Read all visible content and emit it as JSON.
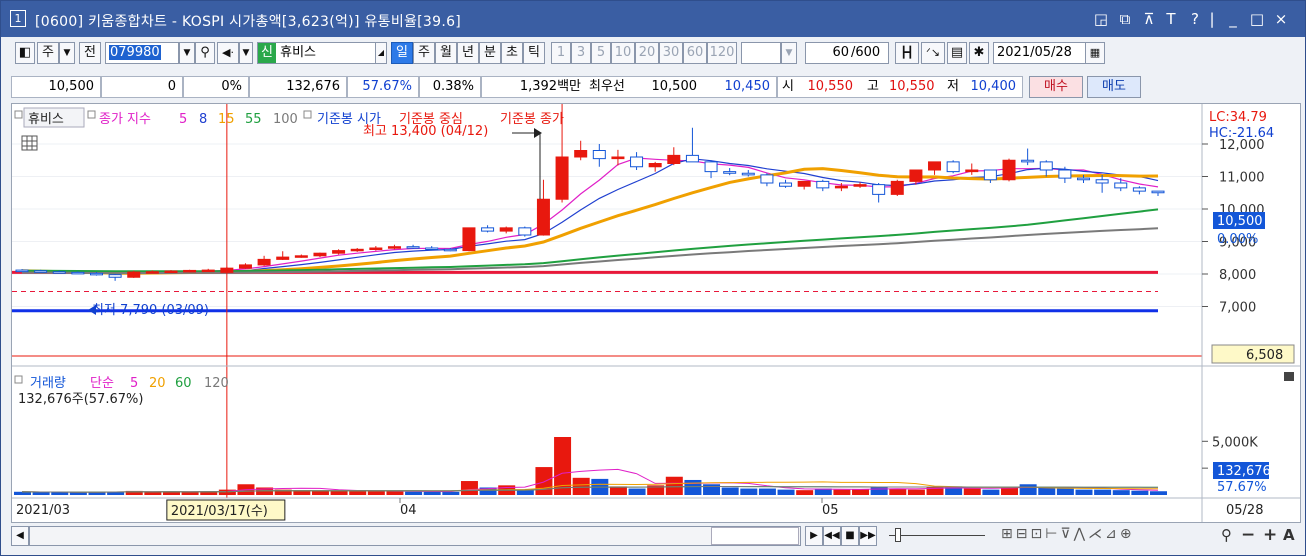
{
  "title": {
    "number": "1",
    "text": "[0600] 키움종합차트 - KOSPI 시가총액[3,623(억)] 유통비율[39.6]"
  },
  "title_controls": [
    "layout-icon",
    "window-icon",
    "pin-icon",
    "font-icon",
    "help-icon",
    "minimize-icon",
    "maximize-icon",
    "close-icon"
  ],
  "toolbar": {
    "stock_label": "주",
    "prev_label": "전",
    "code": "079980",
    "market_badge": "신",
    "name": "휴비스",
    "periods": [
      "일",
      "주",
      "월",
      "년",
      "분",
      "초",
      "틱"
    ],
    "active_period": "일",
    "intervals": [
      "1",
      "3",
      "5",
      "10",
      "20",
      "30",
      "60",
      "120"
    ],
    "count": "60",
    "count_total": "/600",
    "date": "2021/05/28"
  },
  "quote": {
    "price": "10,500",
    "change": "0",
    "rate": "0%",
    "volume": "132,676",
    "volume_ratio": "57.67%",
    "turnover": "0.38%",
    "amount": "1,392백만",
    "best_label": "최우선",
    "ask": "10,500",
    "bid": "10,450",
    "open_label": "시",
    "open": "10,550",
    "high_label": "고",
    "high": "10,550",
    "low_label": "저",
    "low": "10,400",
    "buy": "매수",
    "sell": "매도"
  },
  "price_legend": {
    "name": "휴비스",
    "ma_label": "종가 지수",
    "ma": [
      "5",
      "8",
      "15",
      "55",
      "100"
    ],
    "ref_open": "기준봉 시가",
    "ref_mid": "기준봉 중심",
    "ref_close": "기준봉 종가",
    "max_note": "최고 13,400 (04/12)",
    "min_note": "최저 7,790 (03/09)",
    "lc": "LC:34.79",
    "hc": "HC:-21.64"
  },
  "price_axis": {
    "ticks": [
      "12,000",
      "11,000",
      "10,000",
      "9,000",
      "8,000",
      "7,000"
    ],
    "current": "10,500",
    "current_pct": "0.00%",
    "marker": "6,508"
  },
  "volume_legend": {
    "label": "거래량",
    "ma_label": "단순",
    "ma": [
      "5",
      "20",
      "60",
      "120"
    ],
    "current": "132,676주(57.67%)"
  },
  "volume_axis": {
    "ticks": [
      "5,000K",
      "2,500K"
    ],
    "current": "132,676",
    "pct": "57.67%"
  },
  "date_axis": {
    "labels": [
      "2021/03",
      "04",
      "05",
      "05/28"
    ],
    "crosshair": "2021/03/17(수)"
  },
  "colors": {
    "up": "#e8180e",
    "down": "#1356d8",
    "ma5": "#e020c8",
    "ma8": "#2040d0",
    "ma15": "#f0a000",
    "ma55": "#20a040",
    "ma100": "#7a7a7a",
    "title": "#3a5ea3"
  },
  "chart_data": {
    "type": "candlestick",
    "dates": [
      "03/02",
      "03/03",
      "03/04",
      "03/05",
      "03/08",
      "03/09",
      "03/10",
      "03/11",
      "03/12",
      "03/15",
      "03/16",
      "03/17",
      "03/18",
      "03/19",
      "03/22",
      "03/23",
      "03/24",
      "03/25",
      "03/26",
      "03/29",
      "03/30",
      "03/31",
      "04/01",
      "04/02",
      "04/05",
      "04/06",
      "04/07",
      "04/08",
      "04/09",
      "04/12",
      "04/13",
      "04/14",
      "04/15",
      "04/16",
      "04/19",
      "04/20",
      "04/21",
      "04/22",
      "04/23",
      "04/26",
      "04/27",
      "04/28",
      "04/29",
      "04/30",
      "05/03",
      "05/04",
      "05/06",
      "05/07",
      "05/10",
      "05/11",
      "05/12",
      "05/13",
      "05/14",
      "05/17",
      "05/18",
      "05/20",
      "05/21",
      "05/24",
      "05/25",
      "05/26",
      "05/27",
      "05/28"
    ],
    "ohlc": [
      [
        8120,
        8150,
        8090,
        8100
      ],
      [
        8100,
        8130,
        8050,
        8070
      ],
      [
        8070,
        8110,
        8020,
        8050
      ],
      [
        8050,
        8080,
        8000,
        8020
      ],
      [
        8020,
        8060,
        7950,
        7980
      ],
      [
        7980,
        8000,
        7790,
        7900
      ],
      [
        7900,
        8100,
        7880,
        8060
      ],
      [
        8060,
        8110,
        8030,
        8070
      ],
      [
        8070,
        8120,
        8030,
        8090
      ],
      [
        8090,
        8130,
        8050,
        8110
      ],
      [
        8110,
        8160,
        8080,
        8120
      ],
      [
        8050,
        8220,
        8040,
        8180
      ],
      [
        8180,
        8330,
        8160,
        8280
      ],
      [
        8280,
        8560,
        8250,
        8450
      ],
      [
        8450,
        8700,
        8430,
        8520
      ],
      [
        8520,
        8600,
        8500,
        8560
      ],
      [
        8560,
        8660,
        8520,
        8640
      ],
      [
        8640,
        8760,
        8600,
        8720
      ],
      [
        8720,
        8800,
        8680,
        8760
      ],
      [
        8760,
        8860,
        8720,
        8800
      ],
      [
        8800,
        8900,
        8760,
        8840
      ],
      [
        8840,
        8900,
        8770,
        8800
      ],
      [
        8800,
        8860,
        8720,
        8760
      ],
      [
        8760,
        8800,
        8700,
        8720
      ],
      [
        8720,
        9420,
        8700,
        9420
      ],
      [
        9420,
        9500,
        9280,
        9320
      ],
      [
        9320,
        9460,
        9250,
        9420
      ],
      [
        9420,
        9460,
        9150,
        9200
      ],
      [
        9200,
        10900,
        9180,
        10300
      ],
      [
        10300,
        13400,
        10200,
        11600
      ],
      [
        11600,
        12100,
        11500,
        11800
      ],
      [
        11800,
        12000,
        11300,
        11550
      ],
      [
        11550,
        11820,
        11340,
        11600
      ],
      [
        11600,
        11750,
        11200,
        11300
      ],
      [
        11300,
        11450,
        11150,
        11400
      ],
      [
        11400,
        11900,
        11350,
        11650
      ],
      [
        11650,
        12500,
        11450,
        11450
      ],
      [
        11450,
        11500,
        10950,
        11150
      ],
      [
        11150,
        11260,
        11040,
        11100
      ],
      [
        11100,
        11200,
        11000,
        11050
      ],
      [
        11050,
        11100,
        10700,
        10800
      ],
      [
        10800,
        10900,
        10650,
        10700
      ],
      [
        10700,
        10860,
        10600,
        10850
      ],
      [
        10850,
        10900,
        10550,
        10650
      ],
      [
        10650,
        10800,
        10550,
        10700
      ],
      [
        10700,
        10820,
        10650,
        10750
      ],
      [
        10750,
        10800,
        10200,
        10450
      ],
      [
        10450,
        10900,
        10400,
        10850
      ],
      [
        10850,
        11100,
        10750,
        11200
      ],
      [
        11200,
        11450,
        11050,
        11450
      ],
      [
        11450,
        11500,
        11100,
        11150
      ],
      [
        11150,
        11400,
        11050,
        11200
      ],
      [
        11200,
        11200,
        10800,
        10900
      ],
      [
        10900,
        11550,
        10850,
        11500
      ],
      [
        11500,
        11860,
        11350,
        11450
      ],
      [
        11450,
        11500,
        11000,
        11200
      ],
      [
        11200,
        11300,
        10800,
        10950
      ],
      [
        10950,
        11050,
        10800,
        10900
      ],
      [
        10900,
        11050,
        10500,
        10800
      ],
      [
        10800,
        10950,
        10550,
        10650
      ],
      [
        10650,
        10700,
        10450,
        10550
      ],
      [
        10550,
        10550,
        10400,
        10500
      ]
    ],
    "volume_k": [
      300,
      260,
      280,
      250,
      270,
      320,
      380,
      280,
      300,
      270,
      330,
      500,
      1000,
      700,
      500,
      450,
      420,
      380,
      360,
      340,
      330,
      310,
      300,
      290,
      1300,
      700,
      900,
      500,
      2600,
      5400,
      1600,
      1500,
      800,
      600,
      900,
      1700,
      1400,
      1000,
      700,
      600,
      600,
      500,
      450,
      600,
      500,
      550,
      700,
      600,
      500,
      700,
      800,
      600,
      500,
      650,
      1000,
      700,
      600,
      500,
      500,
      450,
      400,
      350
    ],
    "ref_lines": {
      "high": 8050,
      "mid": 7460,
      "low": 6870
    },
    "crosshair_date": "03/17"
  }
}
